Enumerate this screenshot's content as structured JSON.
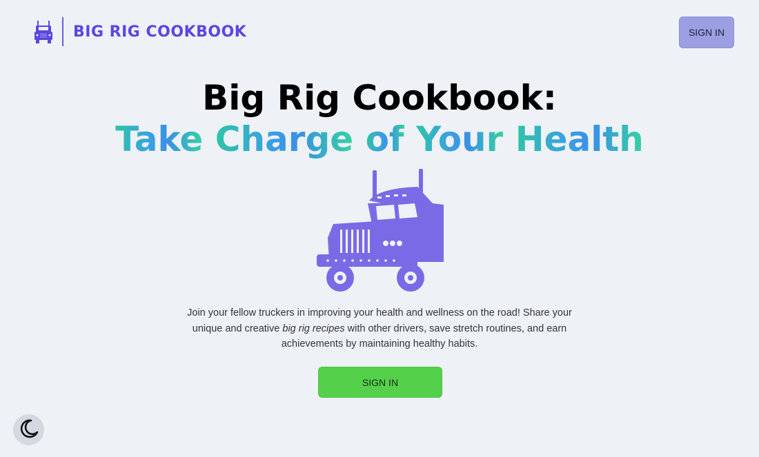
{
  "header": {
    "brand_name": "BIG RIG COOKBOOK",
    "brand_icon": "truck-icon",
    "signin_label": "SIGN IN"
  },
  "hero": {
    "title": "Big Rig Cookbook:",
    "subtitle_words": [
      "Take",
      "Charge",
      "of",
      "Your",
      "Health"
    ],
    "illustration": "semi-truck-illustration",
    "description_part1": "Join your fellow truckers in improving your health and wellness on the road! Share your unique and creative ",
    "description_emphasis": "big rig recipes",
    "description_part2": " with other drivers, save stretch routines, and earn achievements by maintaining healthy habits.",
    "cta_label": "SIGN IN"
  },
  "theme_toggle": {
    "icon": "moon-icon"
  },
  "colors": {
    "brand": "#5b46e0",
    "background": "#eef1f6",
    "header_button": "#9b9ee0",
    "cta_button": "#55d04a",
    "truck": "#7b6ae6",
    "gradient_start": "#2ec4a7",
    "gradient_mid": "#3a90e6",
    "gradient_end": "#34d3a0"
  }
}
